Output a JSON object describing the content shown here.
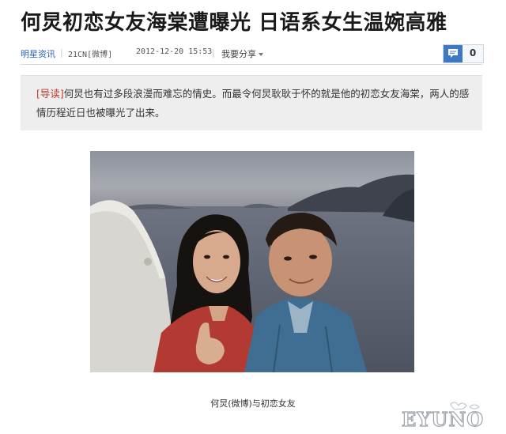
{
  "article": {
    "headline": "何炅初恋女友海棠遭曝光 日语系女生温婉高雅",
    "meta": {
      "source": "明星资讯",
      "origin": "21CN[微博]",
      "time": "2012-12-20 15:53",
      "share_label": "我要分享",
      "comment_count": "0"
    },
    "lead": {
      "tag": "[导读]",
      "text": "何炅也有过多段浪漫而难忘的情史。而最令何炅耿耿于怀的就是他的初恋女友海棠，两人的感情历程近日也被曝光了出来。"
    },
    "photo": {
      "caption": "何炅(微博)与初恋女友"
    }
  },
  "watermark": {
    "text": "EYUNO"
  },
  "colors": {
    "link": "#2b63b5",
    "comment_icon": "#3e79c5",
    "lead_bg": "#eeeeee",
    "lead_tag": "#c0392b"
  }
}
